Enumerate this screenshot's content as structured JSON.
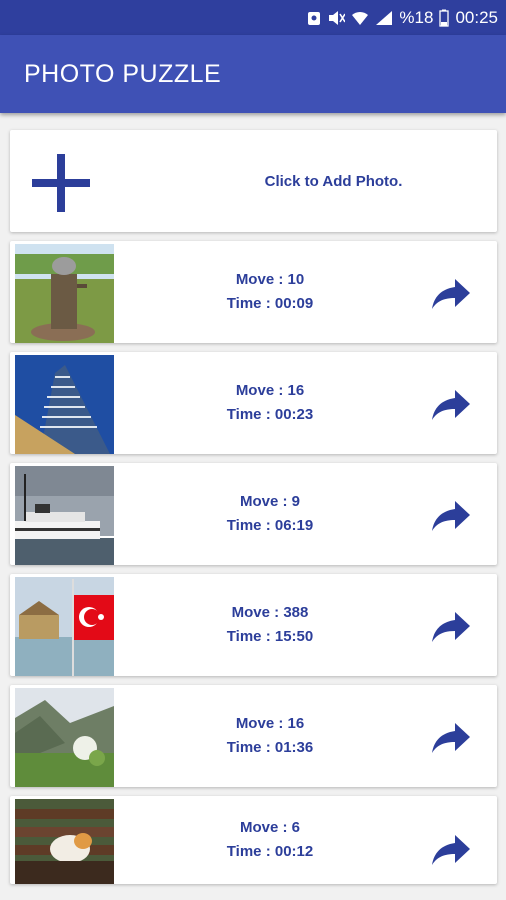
{
  "status_bar": {
    "battery": "%18",
    "time": "00:25"
  },
  "app_bar": {
    "title": "PHOTO PUZZLE"
  },
  "add_photo": {
    "label": "Click to Add Photo."
  },
  "colors": {
    "primary": "#3f51b5",
    "primary_dark": "#2f3f9e",
    "accent": "#2c3e9a"
  },
  "puzzles": [
    {
      "move": "Move : 10",
      "time": "Time : 00:09"
    },
    {
      "move": "Move : 16",
      "time": "Time : 00:23"
    },
    {
      "move": "Move : 9",
      "time": "Time : 06:19"
    },
    {
      "move": "Move : 388",
      "time": "Time : 15:50"
    },
    {
      "move": "Move : 16",
      "time": "Time : 01:36"
    },
    {
      "move": "Move : 6",
      "time": "Time : 00:12"
    }
  ]
}
